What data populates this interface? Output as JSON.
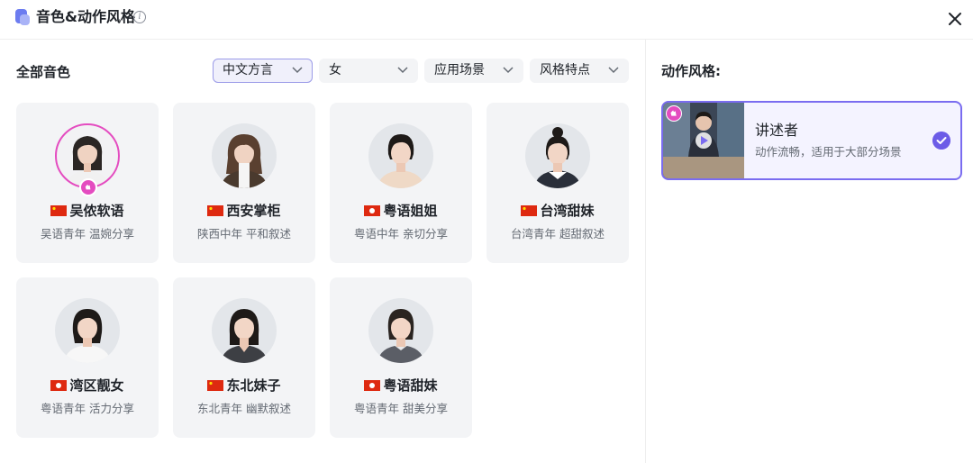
{
  "header": {
    "title": "音色&动作风格",
    "close_icon": "close-icon",
    "info_icon": "info-icon"
  },
  "voices": {
    "section_label": "全部音色",
    "filters": [
      {
        "label": "中文方言",
        "active": true
      },
      {
        "label": "女",
        "active": false
      },
      {
        "label": "应用场景",
        "active": false
      },
      {
        "label": "风格特点",
        "active": false
      }
    ],
    "cards": [
      {
        "name": "吴侬软语",
        "desc": "吴语青年 温婉分享",
        "flag": "cn",
        "selected": true
      },
      {
        "name": "西安掌柜",
        "desc": "陕西中年 平和叙述",
        "flag": "cn",
        "selected": false
      },
      {
        "name": "粤语姐姐",
        "desc": "粤语中年 亲切分享",
        "flag": "hk",
        "selected": false
      },
      {
        "name": "台湾甜妹",
        "desc": "台湾青年 超甜叙述",
        "flag": "cn",
        "selected": false
      },
      {
        "name": "湾区靓女",
        "desc": "粤语青年 活力分享",
        "flag": "hk",
        "selected": false
      },
      {
        "name": "东北妹子",
        "desc": "东北青年 幽默叙述",
        "flag": "cn",
        "selected": false
      },
      {
        "name": "粤语甜妹",
        "desc": "粤语青年 甜美分享",
        "flag": "hk",
        "selected": false
      }
    ]
  },
  "motion": {
    "label": "动作风格:",
    "option": {
      "name": "讲述者",
      "desc": "动作流畅，适用于大部分场景",
      "selected": true
    }
  },
  "colors": {
    "accent": "#7a6cf0",
    "badge": "#e44cc0",
    "card_bg": "#f3f4f6"
  }
}
